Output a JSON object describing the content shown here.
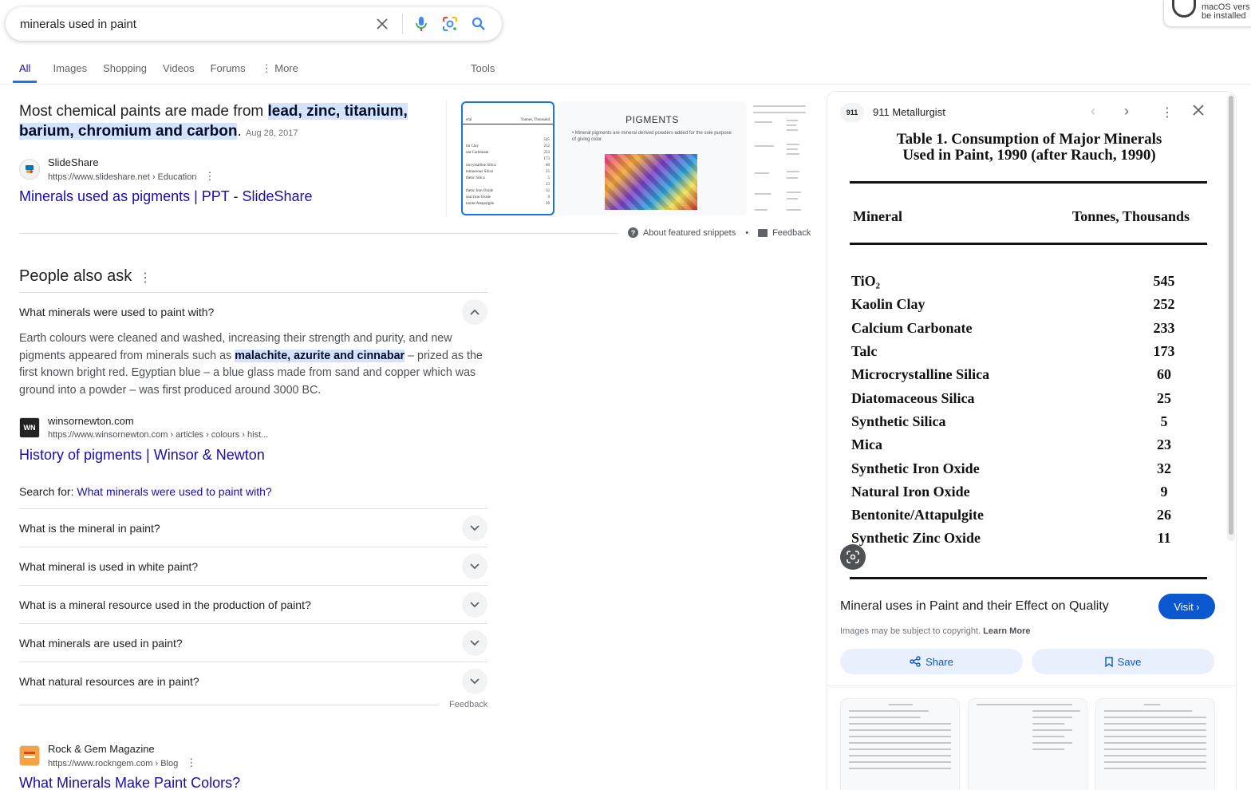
{
  "search": {
    "query": "minerals used in paint"
  },
  "extension_popup": {
    "line1": "macOS vers",
    "line2": "be installed"
  },
  "tabs": [
    {
      "label": "All",
      "active": true
    },
    {
      "label": "Images"
    },
    {
      "label": "Shopping"
    },
    {
      "label": "Videos"
    },
    {
      "label": "Forums"
    },
    {
      "label": "⋮ More"
    }
  ],
  "tools_label": "Tools",
  "featured_snippet": {
    "answer_prefix": "Most chemical paints are made from ",
    "answer_highlight": "lead, zinc, titanium, barium, chromium and carbon",
    "answer_suffix": ".",
    "date": "Aug 28, 2017",
    "source_name": "SlideShare",
    "source_url": "https://www.slideshare.net › Education",
    "link_title": "Minerals used as pigments | PPT - SlideShare",
    "thumb2_title": "PIGMENTS",
    "thumb2_bullet": "• Mineral pigments are mineral derived powders added for the sole purpose of giving color.",
    "about_label": "About featured snippets",
    "feedback_label": "Feedback"
  },
  "paa": {
    "title": "People also ask",
    "expanded_question": "What minerals were used to paint with?",
    "answer_part1": "Earth colours were cleaned and washed, increasing their strength and purity, and new pigments appeared from minerals such as ",
    "answer_highlight": "malachite, azurite and cinnabar",
    "answer_part2": " – prized as the first known bright red. Egyptian blue – a blue glass made from sand and copper which was ground into a powder – was first produced around 3000 BC.",
    "source_name": "winsornewton.com",
    "source_url": "https://www.winsornewton.com › articles › colours › hist...",
    "link_title": "History of pigments | Winsor & Newton",
    "search_for_label": "Search for: ",
    "search_for_link": "What minerals were used to paint with?",
    "questions": [
      "What is the mineral in paint?",
      "What mineral is used in white paint?",
      "What is a mineral resource used in the production of paint?",
      "What minerals are used in paint?",
      "What natural resources are in paint?"
    ],
    "feedback_label": "Feedback"
  },
  "result3": {
    "source_name": "Rock & Gem Magazine",
    "source_url": "https://www.rockngem.com › Blog",
    "link_title": "What Minerals Make Paint Colors?"
  },
  "panel": {
    "source_badge": "911",
    "source_name": "911 Metallurgist",
    "doc_title_line1": "Table 1.  Consumption of Major Minerals",
    "doc_title_line2": "Used in Paint, 1990 (after Rauch, 1990)",
    "col_mineral": "Mineral",
    "col_tonnes": "Tonnes, Thousands",
    "rows": [
      {
        "mineral": "TiO₂",
        "value": "545"
      },
      {
        "mineral": "Kaolin Clay",
        "value": "252"
      },
      {
        "mineral": "Calcium Carbonate",
        "value": "233"
      },
      {
        "mineral": "Talc",
        "value": "173"
      },
      {
        "mineral": "Microcrystalline Silica",
        "value": "60"
      },
      {
        "mineral": "Diatomaceous Silica",
        "value": "25"
      },
      {
        "mineral": "Synthetic Silica",
        "value": "5"
      },
      {
        "mineral": "Mica",
        "value": "23"
      },
      {
        "mineral": "Synthetic Iron Oxide",
        "value": "32"
      },
      {
        "mineral": "Natural Iron Oxide",
        "value": "9"
      },
      {
        "mineral": "Bentonite/Attapulgite",
        "value": "26"
      },
      {
        "mineral": "Synthetic Zinc Oxide",
        "value": "11"
      }
    ],
    "caption": "Mineral uses in Paint and their Effect on Quality",
    "visit_label": "Visit ›",
    "copyright_note": "Images may be subject to copyright. ",
    "learn_more": "Learn More",
    "share_label": "Share",
    "save_label": "Save"
  }
}
